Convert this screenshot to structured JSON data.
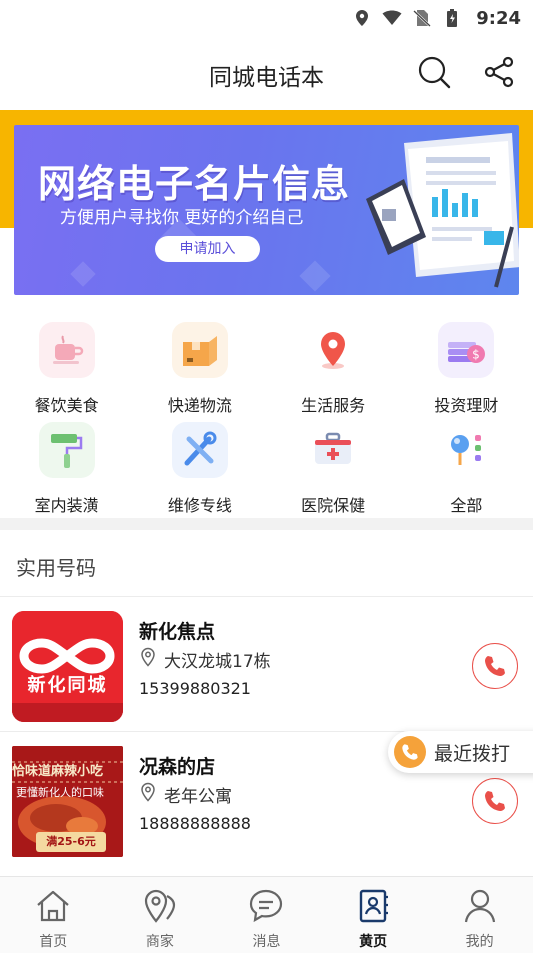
{
  "status_bar": {
    "time": "9:24",
    "icons": [
      "location-icon",
      "wifi-icon",
      "no-sim-icon",
      "battery-icon"
    ]
  },
  "header": {
    "title": "同城电话本",
    "icons": [
      "search-icon",
      "share-icon"
    ]
  },
  "banner": {
    "title": "网络电子名片信息",
    "subtitle": "方便用户寻找你 更好的介绍自己",
    "button_label": "申请加入",
    "colors": {
      "strip": "#f7b500",
      "gradient_start": "#7a6ff2",
      "gradient_end": "#5e86ee"
    }
  },
  "categories": [
    {
      "label": "餐饮美食",
      "icon": "coffee-cup-icon",
      "color": "#f4a9b8"
    },
    {
      "label": "快递物流",
      "icon": "package-box-icon",
      "color": "#f5a64a"
    },
    {
      "label": "生活服务",
      "icon": "map-pin-icon",
      "color": "#f0564a"
    },
    {
      "label": "投资理财",
      "icon": "money-stack-icon",
      "color": "#9b7bf0"
    },
    {
      "label": "室内装潢",
      "icon": "paint-roller-icon",
      "color": "#6cc070"
    },
    {
      "label": "维修专线",
      "icon": "tools-icon",
      "color": "#4a8bea"
    },
    {
      "label": "医院保健",
      "icon": "medical-kit-icon",
      "color": "#ea4f58"
    },
    {
      "label": "全部",
      "icon": "all-grid-icon",
      "color": "#5aa0f0"
    }
  ],
  "section": {
    "title": "实用号码"
  },
  "shops": [
    {
      "name": "新化焦点",
      "address": "大汉龙城17栋",
      "phone": "15399880321",
      "thumb_text": "新化同城",
      "thumb_color": "#e8262d"
    },
    {
      "name": "况森的店",
      "address": "老年公寓",
      "phone": "18888888888",
      "thumb_text_top": "恰味道麻辣小吃",
      "thumb_text_mid": "更懂新化人的口味",
      "thumb_badge": "满25-6元",
      "thumb_color": "#c8201f"
    }
  ],
  "recent_dial": {
    "label": "最近拨打",
    "color": "#f5a23a"
  },
  "bottom_nav": [
    {
      "label": "首页",
      "icon": "home-icon",
      "active": false
    },
    {
      "label": "商家",
      "icon": "location-pins-icon",
      "active": false
    },
    {
      "label": "消息",
      "icon": "chat-bubble-icon",
      "active": false
    },
    {
      "label": "黄页",
      "icon": "contacts-book-icon",
      "active": true
    },
    {
      "label": "我的",
      "icon": "person-icon",
      "active": false
    }
  ],
  "accent_colors": {
    "call_red": "#e9504a"
  }
}
